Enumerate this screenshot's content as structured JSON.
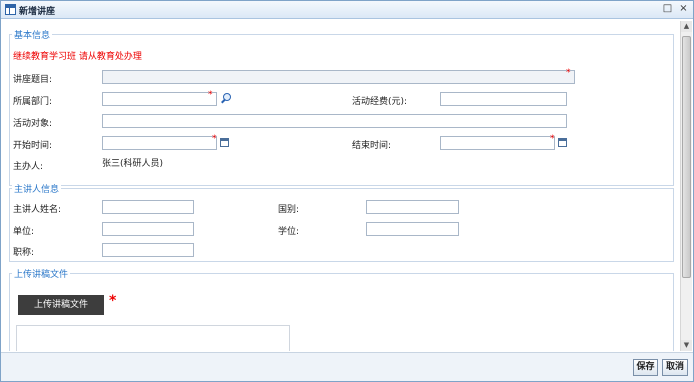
{
  "window": {
    "title": "新增讲座",
    "controls": [
      "□",
      "×"
    ]
  },
  "basic": {
    "legend": "基本信息",
    "notice": "继续教育学习班 请从教育处办理",
    "topic_label": "讲座题目:",
    "dept_label": "所属部门:",
    "budget_label": "活动经费(元):",
    "target_label": "活动对象:",
    "start_label": "开始时间:",
    "end_label": "结束时间:",
    "host_label": "主办人:",
    "host_value": "张三(科研人员)",
    "required_mark": "*"
  },
  "speaker": {
    "legend": "主讲人信息",
    "name_label": "主讲人姓名:",
    "country_label": "国别:",
    "unit_label": "单位:",
    "degree_label": "学位:",
    "title_label": "职称:"
  },
  "upload": {
    "legend": "上传讲稿文件",
    "button_label": "上传讲稿文件",
    "required_mark": "*"
  },
  "footer": {
    "save_label": "保存",
    "cancel_label": "取消"
  },
  "scrollbar": {
    "up": "▲",
    "down": "▼"
  },
  "colors": {
    "accent": "#2a77c9",
    "notice": "#e00000",
    "required": "#e00000",
    "button_dark": "#3d3d3d"
  }
}
